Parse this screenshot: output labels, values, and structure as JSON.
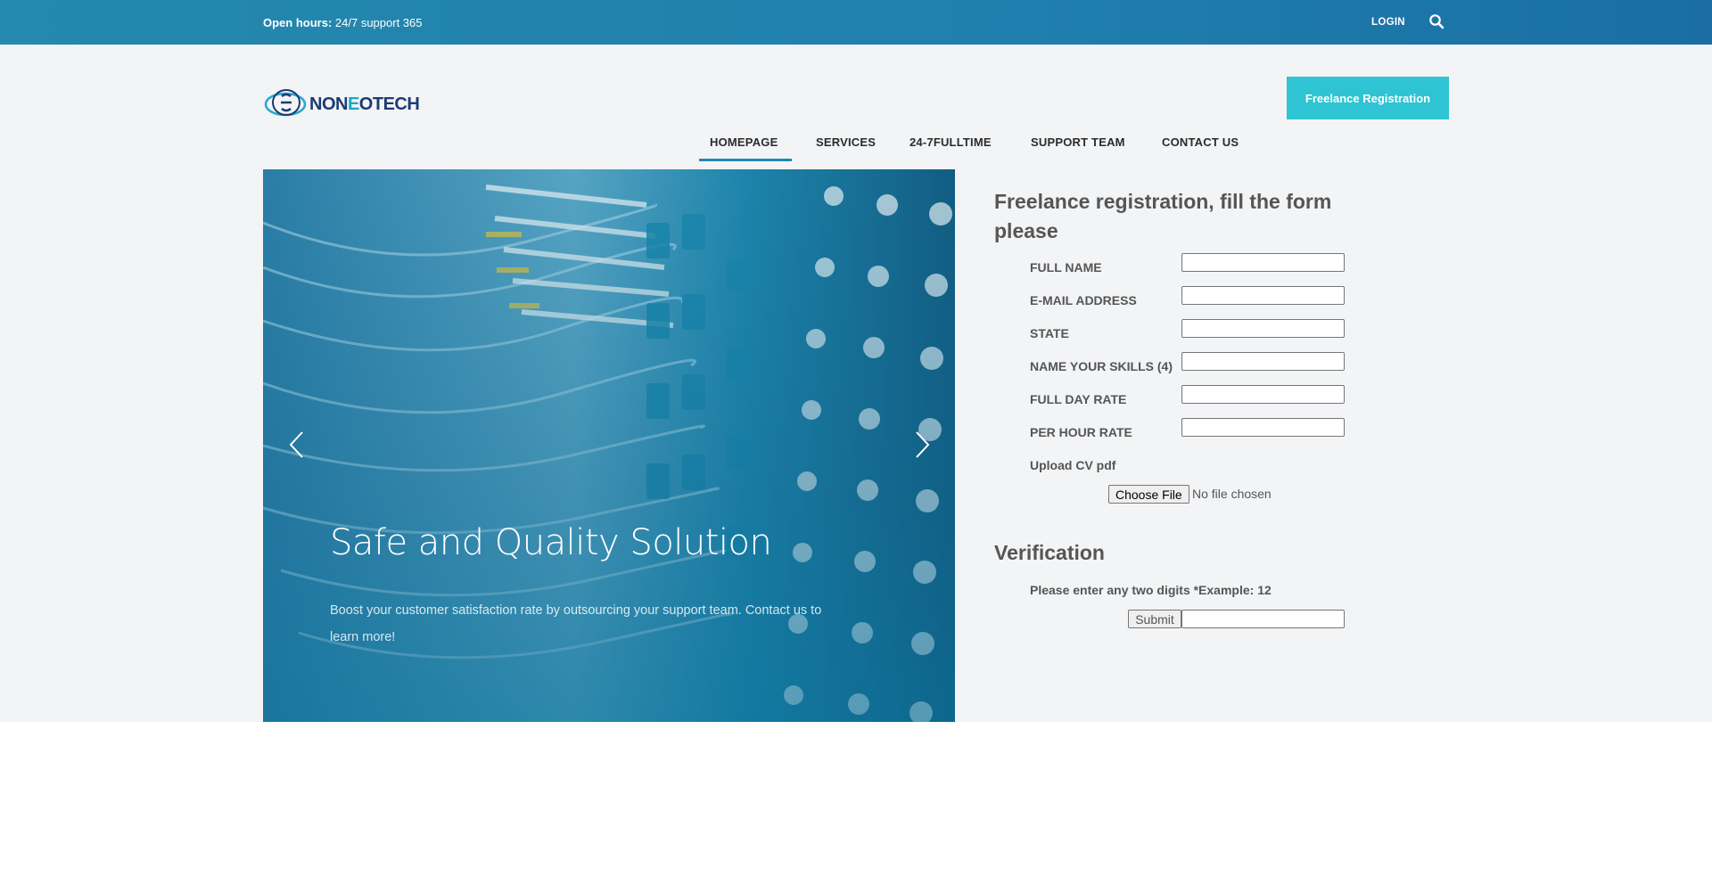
{
  "topbar": {
    "hours_label": "Open hours:",
    "hours_value": "24/7 support 365",
    "login": "LOGIN",
    "search_icon": "search-icon"
  },
  "logo": {
    "prefix": "NON",
    "accent": "E",
    "suffix": "OTECH"
  },
  "nav": {
    "items": [
      {
        "label": "HOMEPAGE",
        "active": true
      },
      {
        "label": "SERVICES"
      },
      {
        "label": "24-7FULLTIME"
      },
      {
        "label": "SUPPORT TEAM"
      },
      {
        "label": "CONTACT US"
      }
    ],
    "cta": "Freelance Registration"
  },
  "hero": {
    "title": "Safe and Quality Solution",
    "text": "Boost your customer satisfaction rate by outsourcing your support team. Contact us to learn more!",
    "prev_icon": "chevron-left-icon",
    "next_icon": "chevron-right-icon"
  },
  "form": {
    "title": "Freelance registration, fill the form please",
    "fields": [
      {
        "label": "FULL NAME",
        "value": ""
      },
      {
        "label": "E-MAIL ADDRESS",
        "value": ""
      },
      {
        "label": "STATE",
        "value": ""
      },
      {
        "label": "NAME YOUR SKILLS (4)",
        "value": ""
      },
      {
        "label": "FULL DAY RATE",
        "value": ""
      },
      {
        "label": "PER HOUR RATE",
        "value": ""
      }
    ],
    "upload_label": "Upload CV pdf",
    "file_button": "Choose File",
    "file_status": "No file chosen",
    "verification_title": "Verification",
    "verification_prompt": "Please enter any two digits *Example: 12",
    "submit": "Submit"
  },
  "colors": {
    "topbar": "#1f7fae",
    "cta": "#2ec4d3",
    "nav_active": "#2089b3",
    "background": "#f3f4f6"
  }
}
